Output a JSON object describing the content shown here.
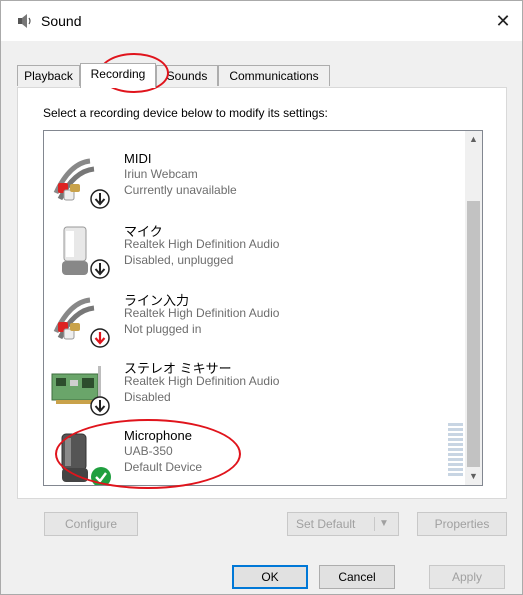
{
  "window": {
    "title": "Sound",
    "close_glyph": "✕"
  },
  "tabs": [
    {
      "label": "Playback",
      "active": false
    },
    {
      "label": "Recording",
      "active": true
    },
    {
      "label": "Sounds",
      "active": false
    },
    {
      "label": "Communications",
      "active": false
    }
  ],
  "instruction": "Select a recording device below to modify its settings:",
  "devices": [
    {
      "name": "MIDI",
      "driver": "Iriun Webcam",
      "status": "Currently unavailable",
      "icon": "rca-cable-icon",
      "badge": "down-arrow-badge"
    },
    {
      "name": "マイク",
      "driver": "Realtek High Definition Audio",
      "status": "Disabled, unplugged",
      "icon": "microphone-icon",
      "badge": "down-arrow-badge"
    },
    {
      "name": "ライン入力",
      "driver": "Realtek High Definition Audio",
      "status": "Not plugged in",
      "icon": "rca-cable-icon",
      "badge": "red-down-arrow-badge"
    },
    {
      "name": "ステレオ ミキサー",
      "driver": "Realtek High Definition Audio",
      "status": "Disabled",
      "icon": "sound-card-icon",
      "badge": "down-arrow-badge"
    },
    {
      "name": "Microphone",
      "driver": "UAB-350",
      "status": "Default Device",
      "icon": "microphone-icon",
      "badge": "green-check-badge"
    }
  ],
  "buttons": {
    "configure": "Configure",
    "set_default": "Set Default",
    "properties": "Properties",
    "ok": "OK",
    "cancel": "Cancel",
    "apply": "Apply"
  },
  "colors": {
    "annotation": "#e0141c",
    "accent": "#0078d7",
    "check": "#1f9f3f"
  }
}
